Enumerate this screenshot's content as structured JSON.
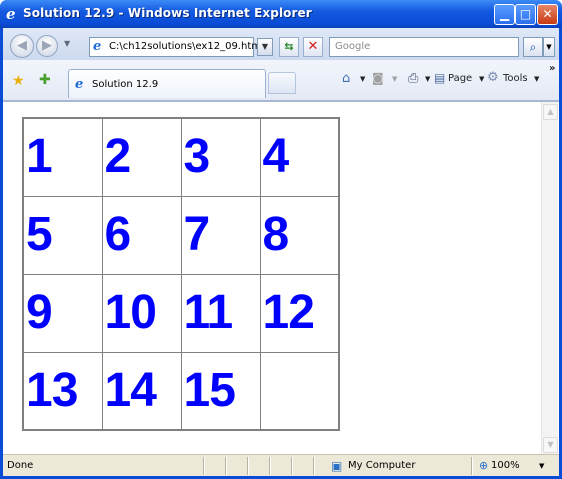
{
  "window": {
    "title": "Solution 12.9 - Windows Internet Explorer",
    "controls": {
      "minimize": "▁",
      "maximize": "□",
      "close": "✕"
    }
  },
  "toolbar": {
    "address": "C:\\ch12solutions\\ex12_09.html",
    "search_placeholder": "Google",
    "back_glyph": "◀",
    "forward_glyph": "▶",
    "refresh_glyph": "⇆",
    "stop_glyph": "✕",
    "search_glyph": "⌕"
  },
  "tabs": [
    {
      "label": "Solution 12.9"
    }
  ],
  "commands": {
    "page_label": "Page",
    "tools_label": "Tools",
    "more": "»"
  },
  "puzzle": {
    "rows": [
      [
        "1",
        "2",
        "3",
        "4"
      ],
      [
        "5",
        "6",
        "7",
        "8"
      ],
      [
        "9",
        "10",
        "11",
        "12"
      ],
      [
        "13",
        "14",
        "15",
        ""
      ]
    ]
  },
  "status": {
    "text": "Done",
    "zone": "My Computer",
    "zoom": "100%"
  },
  "colors": {
    "title_bar": "#0a4cd6",
    "tile_text": "#0000ff",
    "grid_border": "#808080"
  },
  "icons": {
    "ie": "ie-icon",
    "favorites": "star-icon",
    "add_favorites": "add-favorites-icon",
    "home": "home-icon",
    "feeds": "feeds-icon",
    "print": "printer-icon",
    "page": "page-icon",
    "tools": "gear-icon",
    "zone": "computer-icon",
    "zoom": "zoom-icon"
  }
}
